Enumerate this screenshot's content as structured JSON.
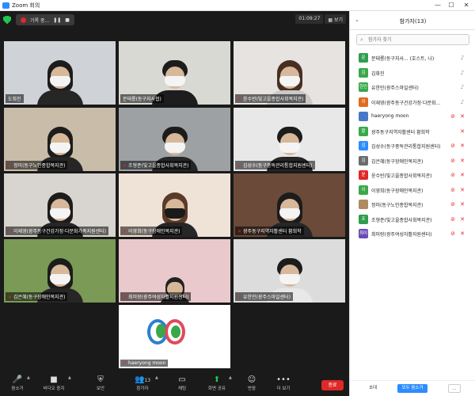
{
  "window": {
    "title": "Zoom 회의",
    "minimize": "—",
    "maximize": "☐",
    "close": "✕"
  },
  "recording": {
    "label": "기록 중...",
    "pause": "❚❚",
    "stop": "■"
  },
  "meeting": {
    "timer": "01:09:27",
    "view_label": "▦ 보기"
  },
  "tiles": [
    {
      "name": "도희진",
      "muted": false,
      "bg": "#cfd2d6"
    },
    {
      "name": "문태룡(동구지사협)",
      "muted": false,
      "bg": "#d9d9d4"
    },
    {
      "name": "윤수빈(빛고을종합사회복지관)",
      "muted": true,
      "bg": "#e6e3e0"
    },
    {
      "name": "정미(동구노인종합복지관)",
      "muted": true,
      "bg": "#c9bca8"
    },
    {
      "name": "조형준(빛고을종합사회복지관)",
      "muted": true,
      "bg": "#9ea1a4"
    },
    {
      "name": "김성수(동구중독관리통합지원센터)",
      "muted": true,
      "bg": "#e8e8e8"
    },
    {
      "name": "이재영(광주동구건강가정·다문화가족지원센터)",
      "muted": true,
      "bg": "#d8d4cf"
    },
    {
      "name": "이영희(동구장애인복지관)",
      "muted": true,
      "bg": "#efe3d8"
    },
    {
      "name": "광주동구지역자활센터 황희학",
      "muted": true,
      "bg": "#6b4a3a"
    },
    {
      "name": "김은혜(동구장애인복지관)",
      "muted": true,
      "bg": "#7a9a55"
    },
    {
      "name": "최미랑(광주여성자활지원센터)",
      "muted": true,
      "bg": "#e9c9cb"
    },
    {
      "name": "유한민(광주스마일센터)",
      "muted": true,
      "bg": "#dcdcdc"
    },
    {
      "name": "haeryong moon",
      "muted": true,
      "bg": "#ffffff"
    }
  ],
  "toolbar": {
    "mute": "음소거",
    "stop_video": "비디오 중지",
    "security": "보안",
    "participants": "참가자",
    "participants_count": "13",
    "chat": "채팅",
    "share_screen": "화면 공유",
    "reactions": "반응",
    "more": "더 보기",
    "end": "종료"
  },
  "panel": {
    "title": "참가자(13)",
    "search_placeholder": "참가자 찾기",
    "invite": "초대",
    "mute_all": "모두 음소거",
    "more": "...",
    "participants": [
      {
        "avatar": "문",
        "name": "문태룡(동구지사... (호스트, 나)",
        "color": "#2e9d4e",
        "muted": false,
        "video_off": false
      },
      {
        "avatar": "김",
        "name": "김화진",
        "color": "#3aa84a",
        "muted": false,
        "video_off": false
      },
      {
        "avatar": "한민",
        "name": "유한민(광주스마일센터)",
        "color": "#3aa84a",
        "muted": false,
        "video_off": false
      },
      {
        "avatar": "이",
        "name": "이재영(광주동구건강가정·다문화...",
        "color": "#e06a1f",
        "muted": false,
        "video_off": false
      },
      {
        "avatar": "",
        "name": "haeryong moon",
        "color": "#4a78c8",
        "muted": true,
        "video_off": true
      },
      {
        "avatar": "황",
        "name": "광주동구지역자활센터 황희학",
        "color": "#3aa84a",
        "muted": true,
        "video_off": false
      },
      {
        "avatar": "김",
        "name": "김성수(동구중독관리통합지원센터)",
        "color": "#2d8cff",
        "muted": true,
        "video_off": true
      },
      {
        "avatar": "김",
        "name": "김은혜(동구장애인복지관)",
        "color": "#6b6b6b",
        "muted": true,
        "video_off": true
      },
      {
        "avatar": "윤",
        "name": "윤수빈(빛고을종합사회복지관)",
        "color": "#e02828",
        "muted": true,
        "video_off": true
      },
      {
        "avatar": "이",
        "name": "이영희(동구장애인복지관)",
        "color": "#3aa84a",
        "muted": true,
        "video_off": true
      },
      {
        "avatar": "",
        "name": "정미(동구노인종합복지관)",
        "color": "#b08a60",
        "muted": true,
        "video_off": true
      },
      {
        "avatar": "조",
        "name": "조형준(빛고을종합사회복지관)",
        "color": "#2e9d4e",
        "muted": true,
        "video_off": true
      },
      {
        "avatar": "최미",
        "name": "최미랑(광주여성자활지원센터)",
        "color": "#6a4ab8",
        "muted": true,
        "video_off": true
      }
    ]
  }
}
